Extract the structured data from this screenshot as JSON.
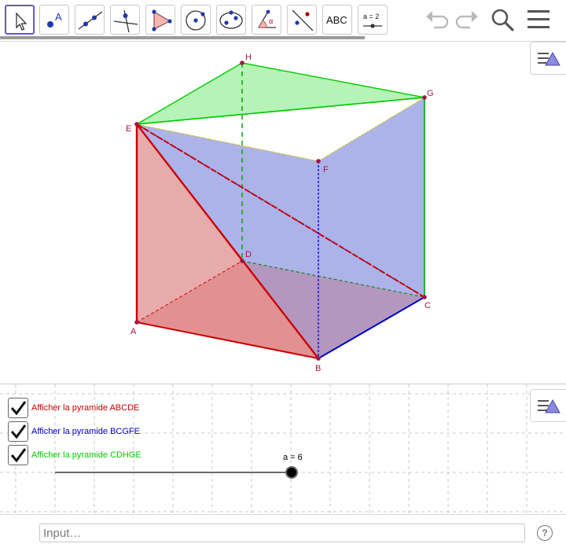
{
  "toolbar": {
    "tools": [
      {
        "icon": "move-arrow-icon"
      },
      {
        "icon": "point-icon",
        "label": "A"
      },
      {
        "icon": "line-icon"
      },
      {
        "icon": "perpendicular-line-icon"
      },
      {
        "icon": "polygon-icon"
      },
      {
        "icon": "circle-center-point-icon"
      },
      {
        "icon": "ellipse-icon"
      },
      {
        "icon": "angle-icon",
        "label": "α"
      },
      {
        "icon": "reflect-icon"
      },
      {
        "icon": "text-tool-icon",
        "label": "ABC"
      },
      {
        "icon": "slider-tool-icon",
        "label": "a = 2"
      }
    ],
    "right": [
      "undo-icon",
      "redo-icon",
      "search-icon",
      "menu-icon"
    ]
  },
  "graphics": {
    "points": {
      "A": "A",
      "B": "B",
      "C": "C",
      "D": "D",
      "E": "E",
      "F": "F",
      "G": "G",
      "H": "H"
    }
  },
  "algebra": {
    "checkboxes": [
      {
        "label": "Afficher la pyramide ABCDE",
        "color": "#cc0000",
        "checked": true
      },
      {
        "label": "Afficher la pyramide BCGFE",
        "color": "#0000cc",
        "checked": true
      },
      {
        "label": "Afficher la pyramide CDHGE",
        "color": "#00cc00",
        "checked": true
      }
    ],
    "slider": {
      "label": "a = 6",
      "value": 6
    }
  },
  "input": {
    "placeholder": "Input…"
  },
  "colors": {
    "red": "#cc0000",
    "blue": "#0000cc",
    "green": "#00cc00",
    "accent": "#6557d2",
    "point": "#a3154a"
  }
}
